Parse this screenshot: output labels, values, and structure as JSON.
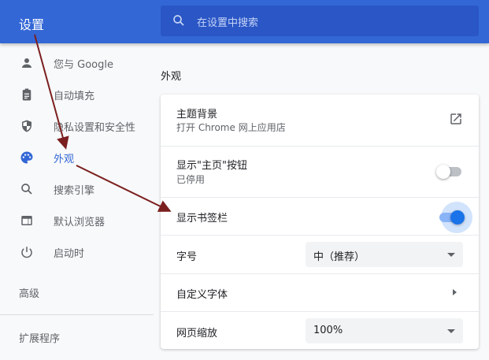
{
  "header": {
    "title": "设置",
    "search_placeholder": "在设置中搜索"
  },
  "nav": {
    "items": [
      {
        "label": "您与 Google",
        "icon": "person-icon"
      },
      {
        "label": "自动填充",
        "icon": "clipboard-icon"
      },
      {
        "label": "隐私设置和安全性",
        "icon": "shield-icon"
      },
      {
        "label": "外观",
        "icon": "palette-icon",
        "active": true
      },
      {
        "label": "搜索引擎",
        "icon": "search-icon"
      },
      {
        "label": "默认浏览器",
        "icon": "browser-icon"
      },
      {
        "label": "启动时",
        "icon": "power-icon"
      }
    ],
    "advanced": "高级",
    "extensions": "扩展程序"
  },
  "section": {
    "title": "外观",
    "theme": {
      "label": "主题背景",
      "sub": "打开 Chrome 网上应用店"
    },
    "home_button": {
      "label": "显示\"主页\"按钮",
      "sub": "已停用",
      "enabled": false
    },
    "bookmarks_bar": {
      "label": "显示书签栏",
      "enabled": true
    },
    "font_size": {
      "label": "字号",
      "value": "中（推荐）"
    },
    "custom_fonts": {
      "label": "自定义字体"
    },
    "page_zoom": {
      "label": "网页缩放",
      "value": "100%"
    }
  },
  "colors": {
    "accent": "#3367d6",
    "toggle_on": "#1a73e8",
    "arrow": "#7b1f1f"
  }
}
